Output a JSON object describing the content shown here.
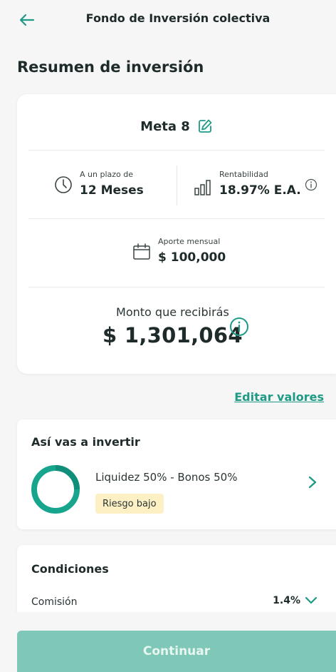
{
  "header": {
    "title": "Fondo de Inversión colectiva",
    "back_icon": "arrow-left-icon"
  },
  "page_title": "Resumen de inversión",
  "summary": {
    "goal_name": "Meta 8",
    "term": {
      "label": "A un plazo de",
      "value": "12 Meses",
      "icon": "clock-icon"
    },
    "return": {
      "label": "Rentabilidad",
      "value": "18.97% E.A.",
      "icon": "bar-chart-icon"
    },
    "monthly": {
      "label": "Aporte mensual",
      "value": "$ 100,000",
      "icon": "calendar-icon"
    },
    "amount": {
      "label": "Monto que recibirás",
      "value": "$ 1,301,064"
    }
  },
  "edit_values_label": "Editar valores",
  "investment": {
    "title": "Así vas a invertir",
    "allocation": "Liquidez 50% - Bonos 50%",
    "risk": "Riesgo bajo"
  },
  "conditions": {
    "title": "Condiciones",
    "commission_label": "Comisión",
    "commission_value": "1.4%"
  },
  "continue_label": "Continuar",
  "colors": {
    "accent": "#1e9a86",
    "button": "#7fc7b6",
    "risk_badge": "#fdf0c4",
    "background": "#f5f6f5"
  }
}
